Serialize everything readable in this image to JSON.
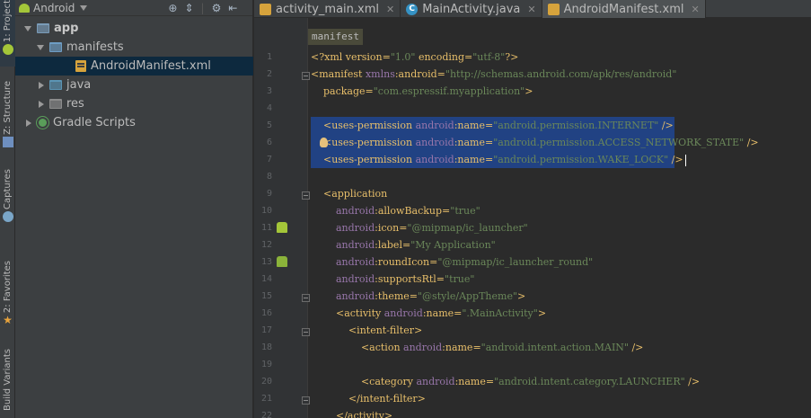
{
  "toolstrip": {
    "tabs": [
      "1: Project",
      "Z: Structure",
      "Captures",
      "2: Favorites",
      "Build Variants"
    ]
  },
  "project": {
    "view": "Android",
    "tree": [
      {
        "label": "app",
        "depth": 0,
        "expanded": true,
        "icon": "module-folder-icon"
      },
      {
        "label": "manifests",
        "depth": 1,
        "expanded": true,
        "icon": "folder-icon"
      },
      {
        "label": "AndroidManifest.xml",
        "depth": 2,
        "selected": true,
        "icon": "xml-file-icon"
      },
      {
        "label": "java",
        "depth": 1,
        "expanded": false,
        "icon": "folder-icon"
      },
      {
        "label": "res",
        "depth": 1,
        "expanded": false,
        "icon": "folder-icon"
      },
      {
        "label": "Gradle Scripts",
        "depth": 0,
        "expanded": false,
        "icon": "gradle-icon"
      }
    ]
  },
  "tabs": [
    {
      "label": "activity_main.xml",
      "icon": "xml-file-icon",
      "active": false
    },
    {
      "label": "MainActivity.java",
      "icon": "java-class-icon",
      "active": false
    },
    {
      "label": "AndroidManifest.xml",
      "icon": "xml-file-icon",
      "active": true
    }
  ],
  "editor": {
    "breadcrumb": "manifest",
    "lines": [
      {
        "n": "1",
        "text": "<?xml version=\"1.0\" encoding=\"utf-8\"?>"
      },
      {
        "n": "2",
        "text": "<manifest xmlns:android=\"http://schemas.android.com/apk/res/android\""
      },
      {
        "n": "3",
        "text": "    package=\"com.espressif.myapplication\">"
      },
      {
        "n": "4",
        "text": ""
      },
      {
        "n": "5",
        "text": "    <uses-permission android:name=\"android.permission.INTERNET\" />"
      },
      {
        "n": "6",
        "text": "    <uses-permission android:name=\"android.permission.ACCESS_NETWORK_STATE\" />"
      },
      {
        "n": "7",
        "text": "    <uses-permission android:name=\"android.permission.WAKE_LOCK\" />"
      },
      {
        "n": "8",
        "text": ""
      },
      {
        "n": "9",
        "text": "    <application"
      },
      {
        "n": "10",
        "text": "        android:allowBackup=\"true\""
      },
      {
        "n": "11",
        "text": "        android:icon=\"@mipmap/ic_launcher\""
      },
      {
        "n": "12",
        "text": "        android:label=\"My Application\""
      },
      {
        "n": "13",
        "text": "        android:roundIcon=\"@mipmap/ic_launcher_round\""
      },
      {
        "n": "14",
        "text": "        android:supportsRtl=\"true\""
      },
      {
        "n": "15",
        "text": "        android:theme=\"@style/AppTheme\">"
      },
      {
        "n": "16",
        "text": "        <activity android:name=\".MainActivity\">"
      },
      {
        "n": "17",
        "text": "            <intent-filter>"
      },
      {
        "n": "18",
        "text": "                <action android:name=\"android.intent.action.MAIN\" />"
      },
      {
        "n": "19",
        "text": ""
      },
      {
        "n": "20",
        "text": "                <category android:name=\"android.intent.category.LAUNCHER\" />"
      },
      {
        "n": "21",
        "text": "            </intent-filter>"
      },
      {
        "n": "22",
        "text": "        </activity>"
      }
    ]
  }
}
